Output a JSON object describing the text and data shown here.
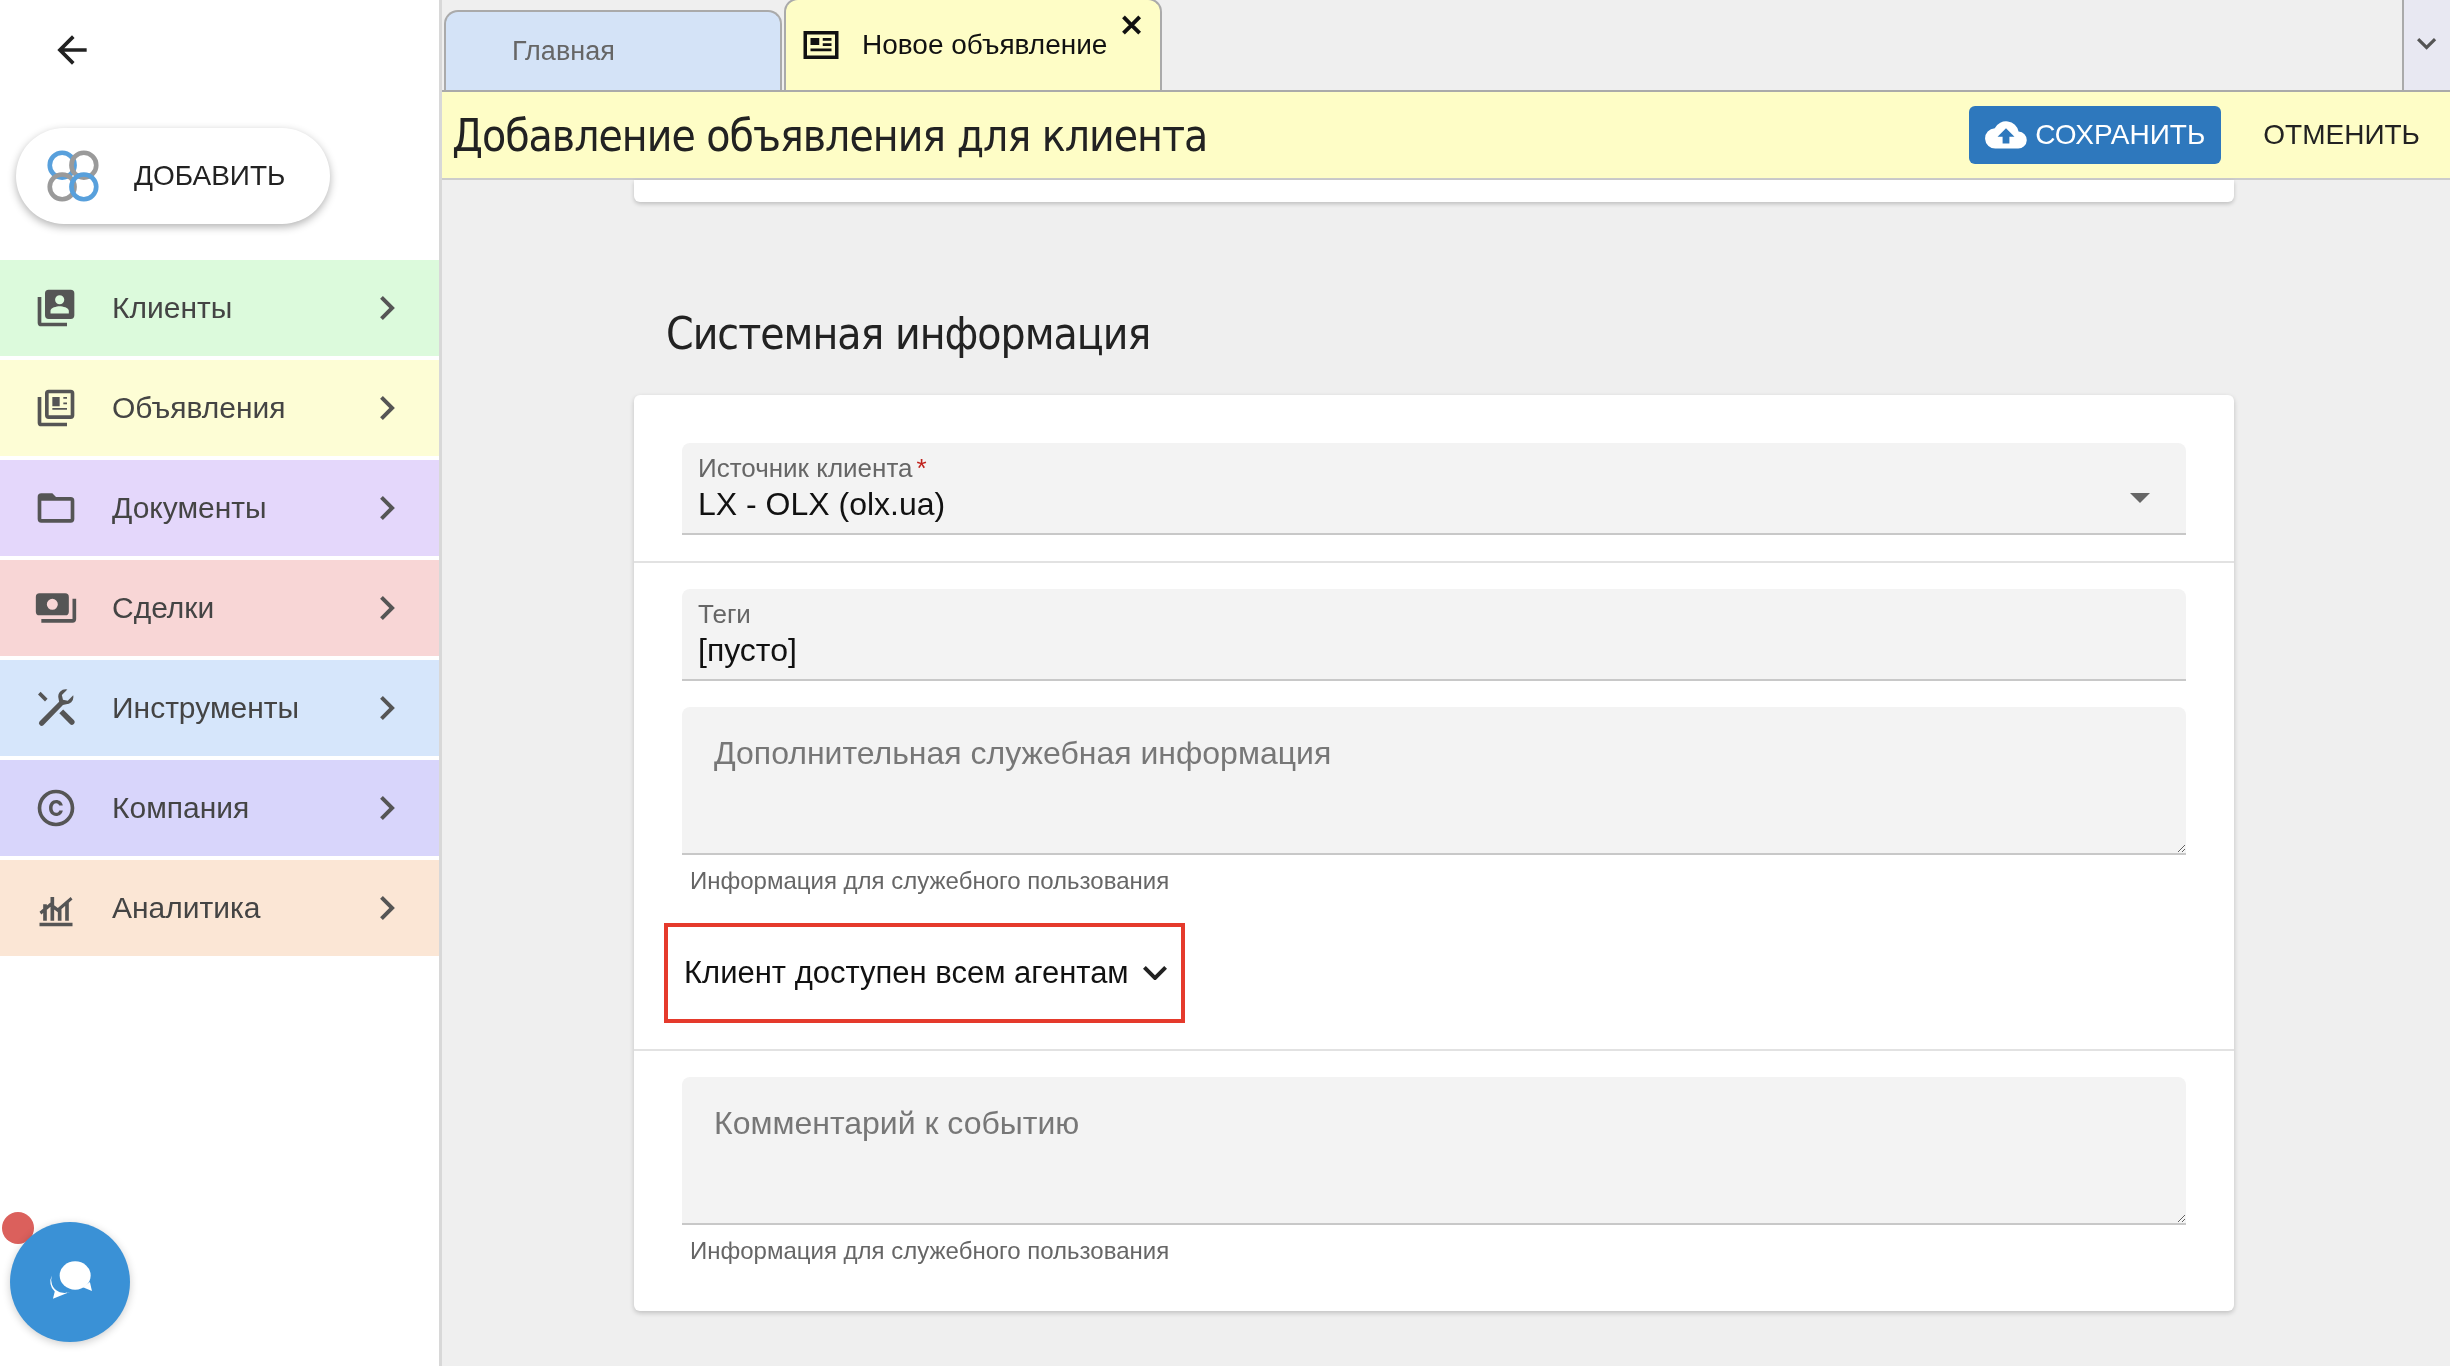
{
  "sidebar": {
    "add_button": "ДОБАВИТЬ",
    "items": [
      {
        "label": "Клиенты",
        "color": "#dcfadc"
      },
      {
        "label": "Объявления",
        "color": "#fdfdd5"
      },
      {
        "label": "Документы",
        "color": "#e4d7fb"
      },
      {
        "label": "Сделки",
        "color": "#f8d6d6"
      },
      {
        "label": "Инструменты",
        "color": "#d6e6fb"
      },
      {
        "label": "Компания",
        "color": "#d8d5fb"
      },
      {
        "label": "Аналитика",
        "color": "#fbe6d5"
      }
    ],
    "chat_unread": true
  },
  "tabs": [
    {
      "label": "Главная",
      "selected": false
    },
    {
      "label": "Новое объявление",
      "selected": true,
      "close": "✕"
    }
  ],
  "header": {
    "title": "Добавление объявления для клиента",
    "save": "СОХРАНИТЬ",
    "cancel": "ОТМЕНИТЬ"
  },
  "section": {
    "title": "Системная информация",
    "fields": [
      {
        "kind": "select",
        "label": "Источник клиента",
        "required_mark": "*",
        "value": "LX - OLX (olx.ua)"
      },
      {
        "kind": "text",
        "label": "Теги",
        "value": "[пусто]"
      },
      {
        "kind": "textarea",
        "placeholder": "Дополнительная служебная информация",
        "helper": "Информация для служебного пользования"
      },
      {
        "kind": "toggle",
        "label": "Клиент доступен всем агентам",
        "highlighted": true
      },
      {
        "kind": "textarea",
        "placeholder": "Комментарий к событию",
        "helper": "Информация для служебного пользования"
      }
    ]
  }
}
